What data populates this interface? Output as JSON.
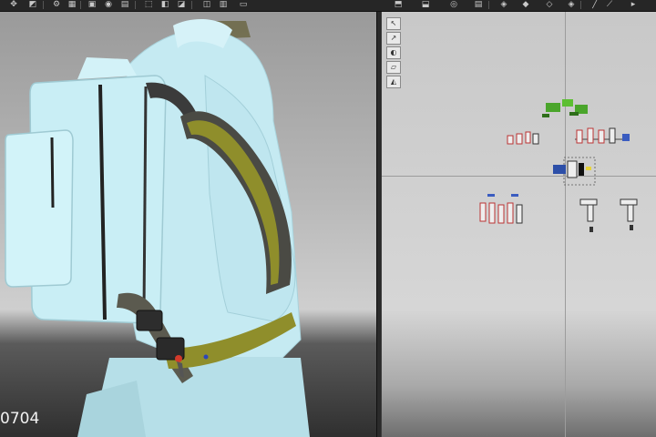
{
  "toolbar": {
    "icons": [
      "move-icon",
      "transform-icon",
      "gear-icon",
      "grid-icon",
      "box-icon",
      "sphere-icon",
      "layers-icon",
      "pattern-icon",
      "segment-icon",
      "fold-icon",
      "pin-icon",
      "sewing-icon",
      "check-icon",
      "pattern-tool-icon",
      "circle-icon",
      "layout-icon",
      "brush-icon",
      "line-icon",
      "pen-icon",
      "more-icon"
    ]
  },
  "viewport3d": {
    "frame_counter": "0704",
    "garment_color": "#c5eaf2",
    "strap_color": "#8f8e2b"
  },
  "viewport2d": {
    "tools": [
      "select-pattern-icon",
      "edit-pattern-icon",
      "transform-icon",
      "sew-icon",
      "fold-icon"
    ]
  }
}
